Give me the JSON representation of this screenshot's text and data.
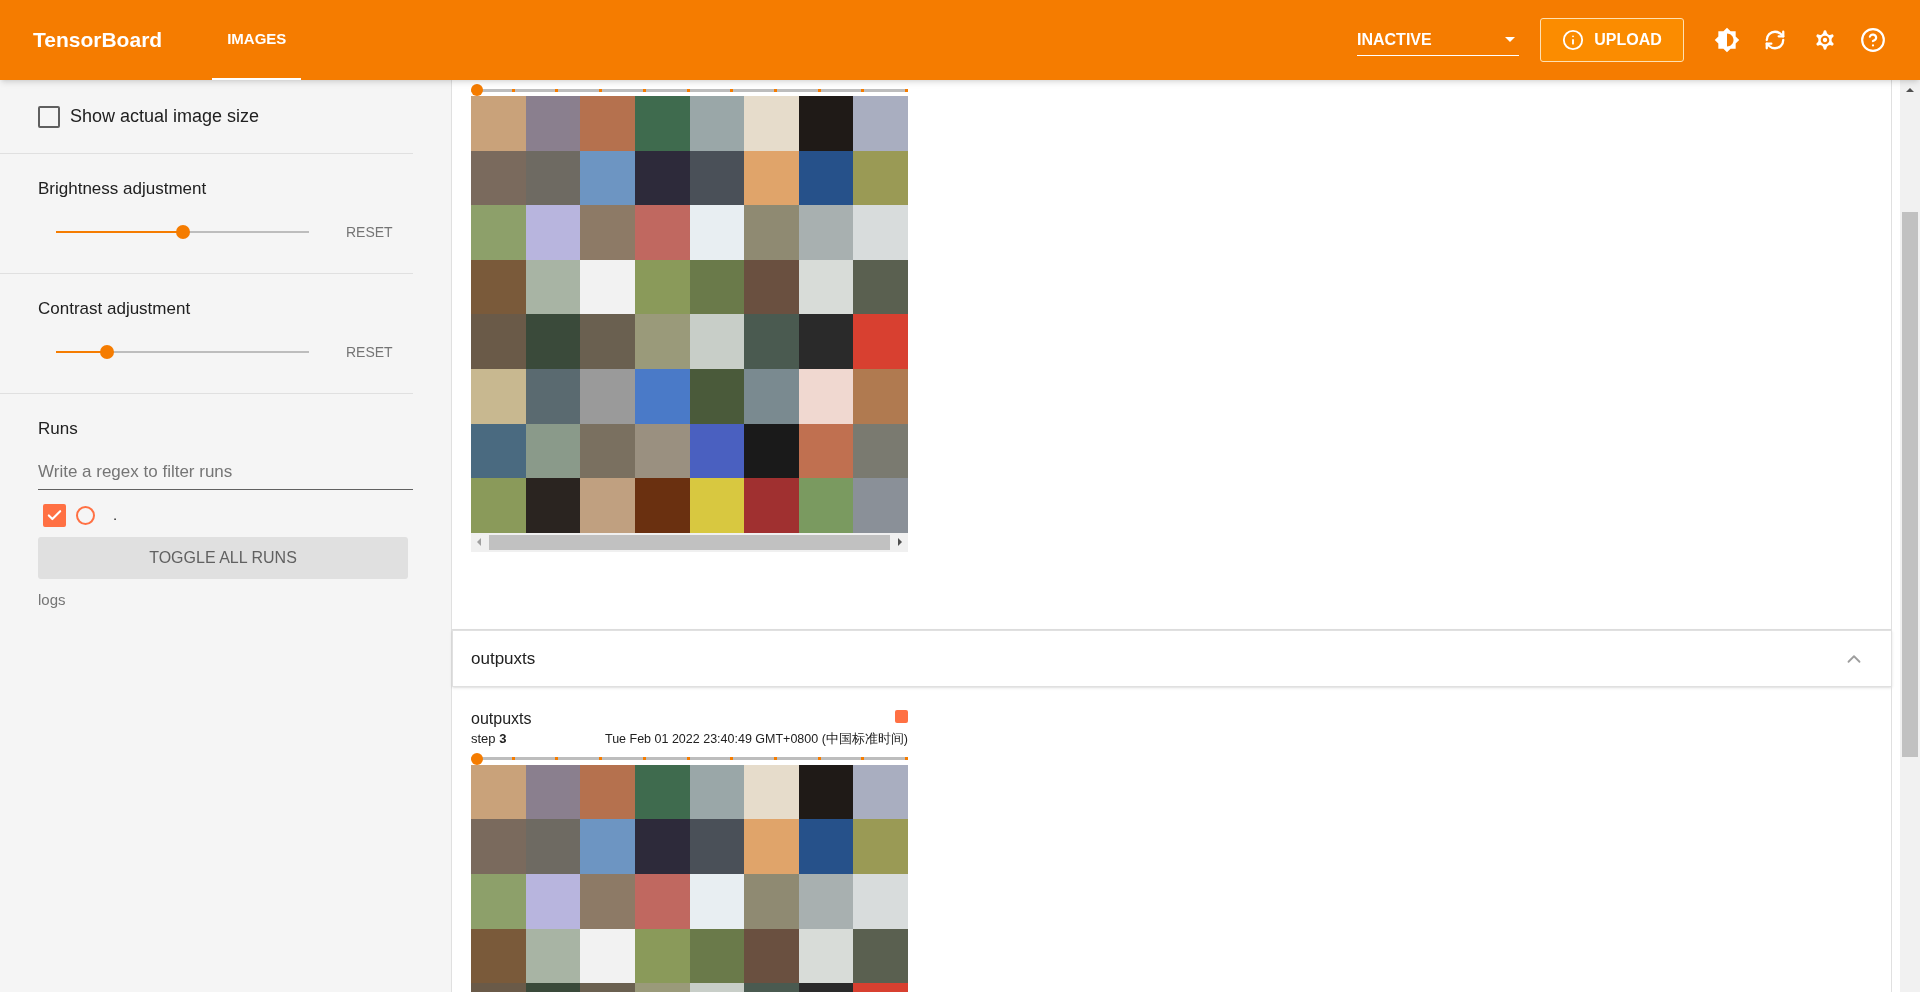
{
  "header": {
    "title": "TensorBoard",
    "tabs": [
      {
        "label": "IMAGES",
        "selected": true
      }
    ],
    "run_selector": {
      "value": "INACTIVE"
    },
    "upload_button": "UPLOAD"
  },
  "sidebar": {
    "show_actual_size": {
      "label": "Show actual image size",
      "checked": false
    },
    "adjustments": [
      {
        "label": "Brightness adjustment",
        "level": 0.5,
        "reset": "RESET"
      },
      {
        "label": "Contrast adjustment",
        "level": 0.2,
        "reset": "RESET"
      }
    ],
    "runs": {
      "title": "Runs",
      "filter": {
        "placeholder": "Write a regex to filter runs"
      },
      "items": [
        {
          "label": ".",
          "checked": true,
          "color": "#ff7043"
        }
      ],
      "toggle_button": "TOGGLE ALL RUNS",
      "footer": "logs"
    }
  },
  "main": {
    "top_card": {
      "step_slider": {
        "level": 0
      }
    },
    "sections": [
      {
        "title": "outpuxts",
        "expanded": true,
        "cards": [
          {
            "title": "outpuxts",
            "step_label": "step",
            "step": "3",
            "time": "Tue Feb 01 2022 23:40:49 GMT+0800 (中国标准时间)",
            "color": "#ff7043",
            "step_slider": {
              "level": 0
            }
          }
        ]
      }
    ]
  }
}
